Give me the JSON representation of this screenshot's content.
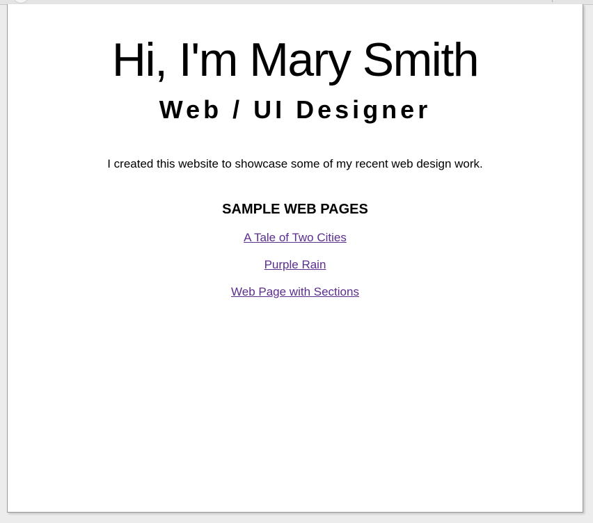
{
  "page": {
    "title": "Hi, I'm Mary Smith",
    "subtitle": "Web / UI Designer",
    "intro": "I created this website to showcase some of my recent web design work.",
    "section_heading": "SAMPLE WEB PAGES",
    "links": [
      {
        "label": "A Tale of Two Cities"
      },
      {
        "label": "Purple Rain"
      },
      {
        "label": "Web Page with Sections"
      }
    ]
  },
  "colors": {
    "link_visited": "#5b2d8e",
    "text": "#000000",
    "background": "#ffffff"
  }
}
